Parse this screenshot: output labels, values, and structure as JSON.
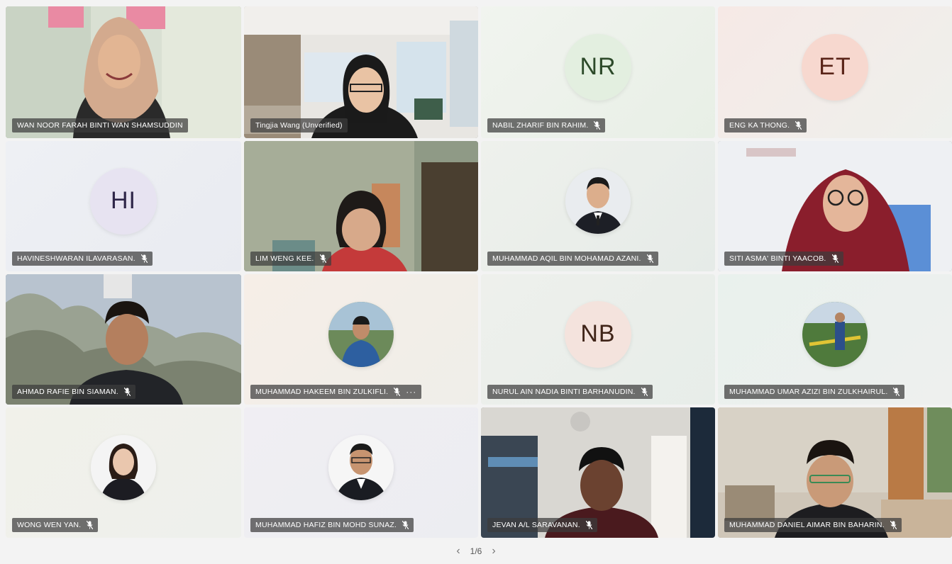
{
  "participants": [
    {
      "name": "WAN NOOR FARAH BINTI WAN SHAMSUDDIN"
    },
    {
      "name": "Tingjia Wang (Unverified)"
    },
    {
      "name": "NABIL ZHARIF BIN RAHIM.",
      "initials": "NR"
    },
    {
      "name": "ENG KA THONG.",
      "initials": "ET"
    },
    {
      "name": "HAVINESHWARAN ILAVARASAN.",
      "initials": "HI"
    },
    {
      "name": "LIM WENG KEE."
    },
    {
      "name": "MUHAMMAD AQIL BIN MOHAMAD AZANI."
    },
    {
      "name": "SITI ASMA' BINTI YAACOB."
    },
    {
      "name": "AHMAD RAFIE BIN SIAMAN."
    },
    {
      "name": "MUHAMMAD HAKEEM BIN ZULKIFLI.",
      "more": "···"
    },
    {
      "name": "NURUL AIN NADIA BINTI BARHANUDIN.",
      "initials": "NB"
    },
    {
      "name": "MUHAMMAD UMAR AZIZI BIN ZULKHAIRUL."
    },
    {
      "name": "WONG WEN YAN."
    },
    {
      "name": "MUHAMMAD HAFIZ BIN MOHD SUNAZ."
    },
    {
      "name": "JEVAN A/L SARAVANAN."
    },
    {
      "name": "MUHAMMAD DANIEL AIMAR BIN BAHARIN."
    }
  ],
  "pager": {
    "text": "1/6",
    "prev": "‹",
    "next": "›"
  },
  "colors": {
    "nr_bg": "#e3efe0",
    "nr_fg": "#2d4a2a",
    "et_bg": "#f7d8cf",
    "et_fg": "#5a2418",
    "hi_bg": "#e7e3f1",
    "hi_fg": "#2e2548",
    "nb_bg": "#f4e3dd",
    "nb_fg": "#3f2418"
  }
}
